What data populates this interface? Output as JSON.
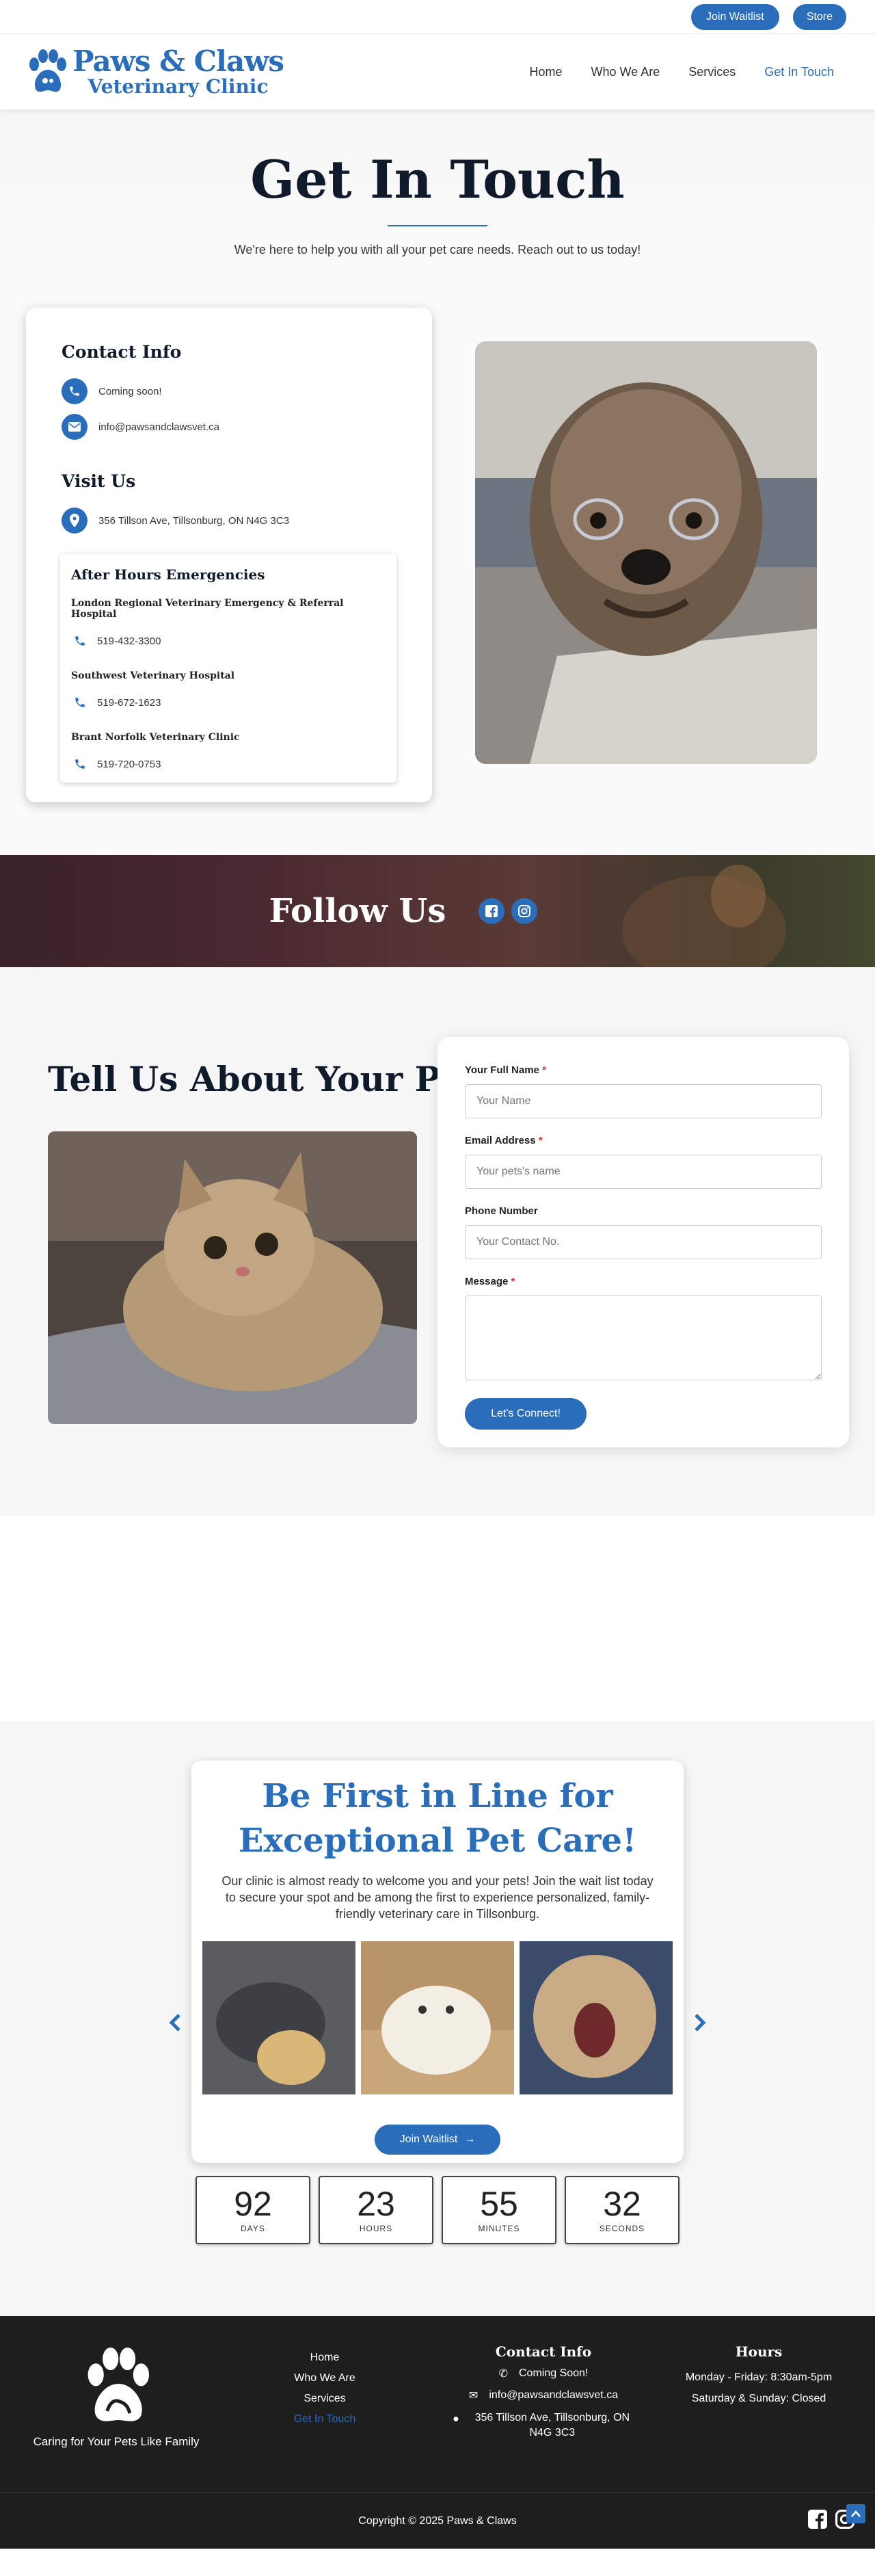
{
  "topbar": {
    "waitlist": "Join Waitlist",
    "store": "Store"
  },
  "header": {
    "logo_title": "Paws & Claws",
    "logo_subtitle": "Veterinary Clinic",
    "nav": [
      "Home",
      "Who We Are",
      "Services",
      "Get In Touch"
    ],
    "active": "Get In Touch"
  },
  "hero": {
    "title": "Get In Touch",
    "subtitle": "We're here to help you with all your pet care needs. Reach out to us today!"
  },
  "contact": {
    "heading": "Contact Info",
    "phone": "Coming soon!",
    "email": "info@pawsandclawsvet.ca",
    "visit_heading": "Visit Us",
    "address": "356 Tillson Ave, Tillsonburg, ON N4G 3C3",
    "emergency_heading": "After Hours Emergencies",
    "hospitals": [
      {
        "name": "London Regional Veterinary Emergency & Referral Hospital",
        "phone": "519-432-3300"
      },
      {
        "name": "Southwest Veterinary Hospital",
        "phone": "519-672-1623"
      },
      {
        "name": "Brant Norfolk Veterinary Clinic",
        "phone": "519-720-0753"
      }
    ]
  },
  "follow": {
    "title": "Follow Us"
  },
  "tell": {
    "title": "Tell Us About Your Pet",
    "fields": {
      "name_label": "Your Full Name",
      "name_placeholder": "Your Name",
      "email_label": "Email Address",
      "email_placeholder": "Your pets's name",
      "phone_label": "Phone Number",
      "phone_placeholder": "Your Contact No.",
      "message_label": "Message",
      "required_mark": "*"
    },
    "submit": "Let's Connect!"
  },
  "waitlist": {
    "title_line1": "Be First in Line for",
    "title_line2": "Exceptional Pet Care!",
    "body": "Our clinic is almost ready to welcome you and your pets! Join the wait list today to secure your spot and be among the first to experience personalized, family-friendly veterinary care in Tillsonburg.",
    "button": "Join Waitlist",
    "countdown": [
      {
        "value": "92",
        "label": "DAYS"
      },
      {
        "value": "23",
        "label": "HOURS"
      },
      {
        "value": "55",
        "label": "MINUTES"
      },
      {
        "value": "32",
        "label": "SECONDS"
      }
    ]
  },
  "footer": {
    "tagline": "Caring for Your Pets Like Family",
    "links": [
      "Home",
      "Who We Are",
      "Services",
      "Get In Touch"
    ],
    "contact_heading": "Contact Info",
    "phone": "Coming Soon!",
    "email": "info@pawsandclawsvet.ca",
    "address": "356 Tillson Ave, Tillsonburg, ON N4G 3C3",
    "hours_heading": "Hours",
    "hours": [
      "Monday - Friday: 8:30am-5pm",
      "Saturday & Sunday: Closed"
    ],
    "copyright": "Copyright © 2025 Paws & Claws"
  },
  "colors": {
    "accent": "#2a6ebb",
    "dark": "#1e1e1e",
    "heading": "#0f1a2a"
  }
}
